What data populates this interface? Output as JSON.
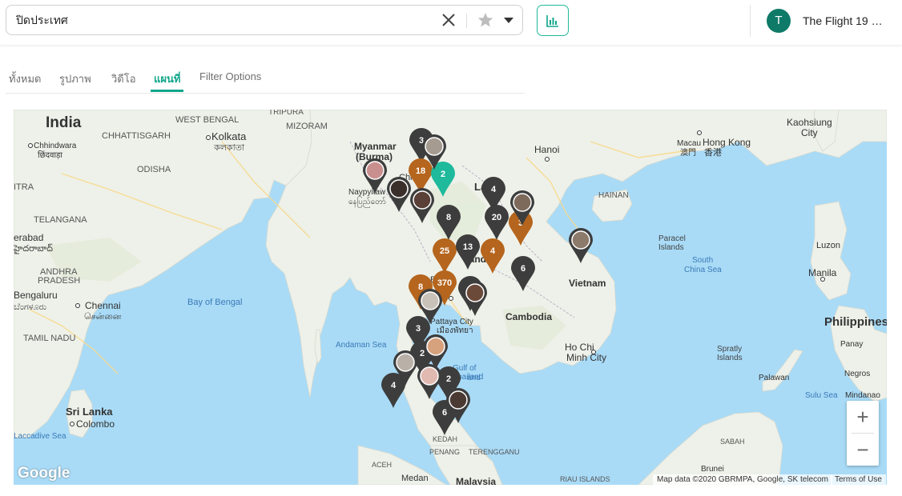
{
  "search": {
    "value": "ปิดประเทศ",
    "placeholder": ""
  },
  "user": {
    "initial": "T",
    "name": "The Flight 19 …"
  },
  "tabs": [
    {
      "label": "ทั้งหมด"
    },
    {
      "label": "รูปภาพ"
    },
    {
      "label": "วิดีโอ"
    },
    {
      "label": "แผนที่"
    },
    {
      "label": "Filter Options"
    }
  ],
  "active_tab": "แผนที่",
  "map": {
    "labels": [
      "India",
      "WEST BENGAL",
      "TRIPURA",
      "MIZORAM",
      "Kolkata",
      "কলকাতা",
      "CHHATTISGARH",
      "Chhindwara",
      "छिंदवाड़ा",
      "ODISHA",
      "ITRA",
      "TELANGANA",
      "erabad",
      "హైదరాబాద్",
      "ANDHRA",
      "PRADESH",
      "Bengaluru",
      "ಬೆಂಗಳೂರು",
      "Chennai",
      "சென்னை",
      "TAMIL NADU",
      "Bay of Bengal",
      "Sri Lanka",
      "Colombo",
      "Laccadive Sea",
      "Myanmar",
      "(Burma)",
      "Naypyitaw",
      "နေပြည်တော်",
      "Andaman Sea",
      "Laos",
      "Hanoi",
      "HAINAN",
      "Macau",
      "澳門",
      "Hong Kong",
      "香港",
      "Kaohsiung",
      "City",
      "Paracel",
      "Islands",
      "South",
      "China Sea",
      "Vietnam",
      "Cambodia",
      "Pattaya City",
      "เมืองพัทยา",
      "Ho Chi",
      "Minh City",
      "Gulf of",
      "Thailand",
      "Spratly",
      "Islands",
      "Luzon",
      "Manila",
      "Philippines",
      "Panay",
      "Negros",
      "Palawan",
      "Sulu Sea",
      "Mindanao",
      "KEDAH",
      "PENANG",
      "TERENGGANU",
      "ACEH",
      "Medan",
      "Malaysia",
      "SABAH",
      "Brunei",
      "RIAU ISLANDS",
      "Chi",
      "Ba",
      "iland",
      "and"
    ],
    "cluster_counts": [
      "3",
      "18",
      "2",
      "4",
      "20",
      "3",
      "8",
      "25",
      "4",
      "13",
      "6",
      "8",
      "370",
      "11",
      "3",
      "2",
      "4",
      "2",
      "6"
    ],
    "attribution": "Map data ©2020 GBRMPA, Google, SK telecom",
    "terms": "Terms of Use",
    "logo": "Google",
    "zoom_in": "+",
    "zoom_out": "−"
  },
  "colors": {
    "accent": "#10a68b",
    "pin_dark": "#3d3d3d",
    "pin_orange": "#b5651d",
    "pin_teal": "#1fb99c",
    "water": "#a9dbf7",
    "land": "#eef1e9"
  },
  "icons": {
    "clear": "close-icon",
    "star": "star-icon",
    "dropdown": "caret-down-icon",
    "stats": "bar-chart-icon",
    "zoom_in": "plus-icon",
    "zoom_out": "minus-icon"
  }
}
